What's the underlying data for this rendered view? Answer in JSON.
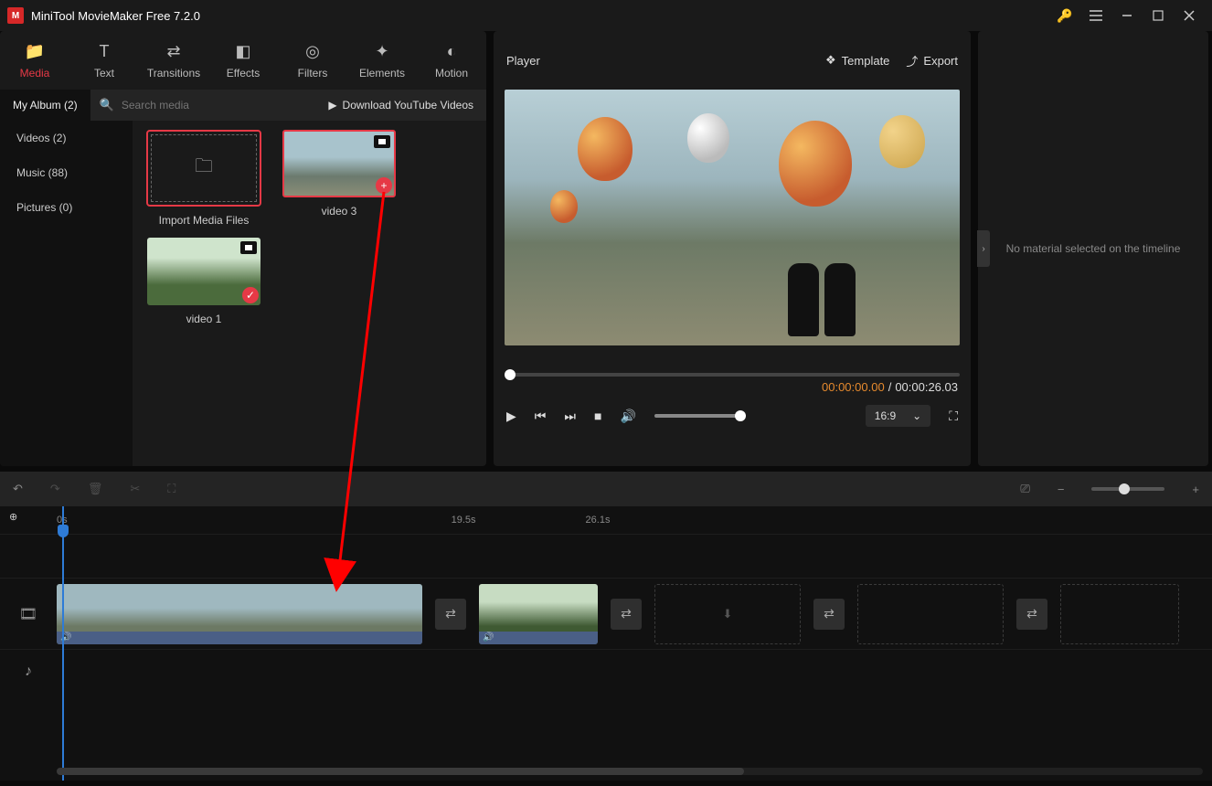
{
  "app": {
    "title": "MiniTool MovieMaker Free 7.2.0"
  },
  "toolTabs": {
    "media": "Media",
    "text": "Text",
    "transitions": "Transitions",
    "effects": "Effects",
    "filters": "Filters",
    "elements": "Elements",
    "motion": "Motion"
  },
  "mediaPanel": {
    "albumTab": "My Album (2)",
    "searchPlaceholder": "Search media",
    "downloadYT": "Download YouTube Videos",
    "nav": {
      "videos": "Videos (2)",
      "music": "Music (88)",
      "pictures": "Pictures (0)"
    },
    "import": "Import Media Files",
    "item1": "video 3",
    "item2": "video 1"
  },
  "player": {
    "title": "Player",
    "template": "Template",
    "export": "Export",
    "curTime": "00:00:00.00",
    "sep": "/",
    "totTime": "00:00:26.03",
    "ratio": "16:9"
  },
  "rightPanel": {
    "message": "No material selected on the timeline"
  },
  "timeline": {
    "t0": "0s",
    "t1": "19.5s",
    "t2": "26.1s"
  }
}
